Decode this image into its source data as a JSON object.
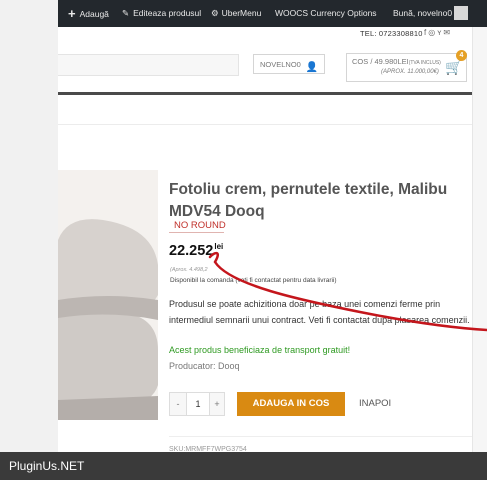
{
  "admin_bar": {
    "add_label": "Adaugă",
    "edit_label": "Editeaza produsul",
    "ubermenu_label": "UberMenu",
    "currency_label": "WOOCS Currency Options",
    "greeting": "Bună, novelno0"
  },
  "topbar": {
    "phone": "TEL: 0723308810",
    "social_icons": [
      "facebook-icon",
      "instagram-icon",
      "twitter-icon",
      "email-icon"
    ]
  },
  "header": {
    "account_label": "NOVELNO0",
    "cart": {
      "label": "COS / 49.980LEI",
      "vat_note": "(TVA INCLUS)",
      "approx": "(APROX. 11.000,00€)",
      "count": "4"
    }
  },
  "product": {
    "title": "Fotoliu crem, pernutele textile, Malibu MDV54 Dooq",
    "badge": "NO ROUND",
    "price": "22.252",
    "currency": "lei",
    "approx": "(Aprox. 4.498,2",
    "availability": "Disponibil la comanda (veti fi contactat pentru data livrarii)",
    "description": "Produsul se poate achizitiona doar pe baza unei comenzi ferme prin intermediul semnarii unui contract. Veti fi contactat dupa plasarea comenzii.",
    "transport": "Acest produs beneficiaza de transport gratuit!",
    "producer_label": "Producator:",
    "producer": "Dooq",
    "quantity": "1",
    "qty_minus": "-",
    "qty_plus": "+",
    "add_to_cart": "ADAUGA IN COS",
    "back": "INAPOI",
    "sku": "SKU:MRMFF7WPG3754"
  },
  "footer": {
    "brand": "PluginUs.NET"
  },
  "colors": {
    "admin_bar": "#23282d",
    "accent_button": "#d98a12",
    "transport_green": "#2f9a22",
    "badge_red": "#c0302a",
    "scribble_red": "#c4161c"
  }
}
